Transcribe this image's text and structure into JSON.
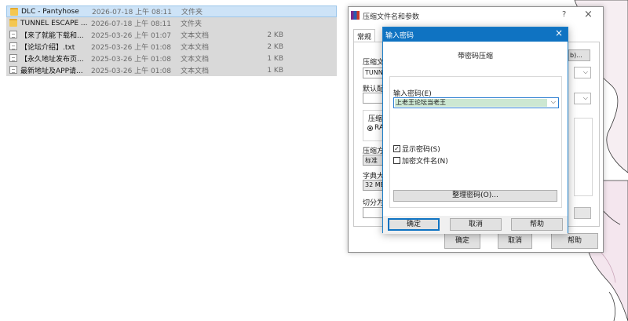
{
  "file_list": [
    {
      "name": "DLC - Pantyhose",
      "date": "2026-07-18 上午 08:11",
      "type": "文件夹",
      "size": "",
      "icon": "folder-icon"
    },
    {
      "name": "TUNNEL ESCAPE ...",
      "date": "2026-07-18 上午 08:11",
      "type": "文件夹",
      "size": "",
      "icon": "folder-icon"
    },
    {
      "name": "【来了就能下载和...",
      "date": "2025-03-26 上午 01:07",
      "type": "文本文档",
      "size": "2 KB",
      "icon": "text-file-icon"
    },
    {
      "name": "【论坛介绍】.txt",
      "date": "2025-03-26 上午 01:08",
      "type": "文本文档",
      "size": "2 KB",
      "icon": "text-file-icon"
    },
    {
      "name": "【永久地址发布页...",
      "date": "2025-03-26 上午 01:08",
      "type": "文本文档",
      "size": "1 KB",
      "icon": "text-file-icon"
    },
    {
      "name": "最新地址及APP请...",
      "date": "2025-03-26 上午 01:08",
      "type": "文本文档",
      "size": "1 KB",
      "icon": "text-file-icon"
    }
  ],
  "archive_dialog": {
    "title": "压缩文件名和参数",
    "help": "?",
    "close": "×",
    "tab_general": "常规",
    "archive_name_label": "压缩文",
    "archive_name_value": "TUNNE",
    "browse_label": "b)...",
    "profile_label": "默认配",
    "format_label": "压缩",
    "format_radio": "RA",
    "method_label": "压缩方",
    "method_value": "标准",
    "dict_label": "字典大",
    "dict_value": "32 MB",
    "split_label": "切分为",
    "ok": "确定",
    "cancel": "取消",
    "help_button": "帮助"
  },
  "password_dialog": {
    "title": "输入密码",
    "close": "×",
    "heading": "带密码压缩",
    "password_label": "输入密码(E)",
    "password_value": "上老王论坛当老王",
    "show_password": "显示密码(S)",
    "encrypt_filenames": "加密文件名(N)",
    "manage_passwords": "整理密码(O)...",
    "ok": "确定",
    "cancel": "取消",
    "help": "帮助"
  },
  "colors": {
    "accent": "#0f73c2",
    "selection": "#cde3f7",
    "password_highlight": "#cce7d2"
  }
}
